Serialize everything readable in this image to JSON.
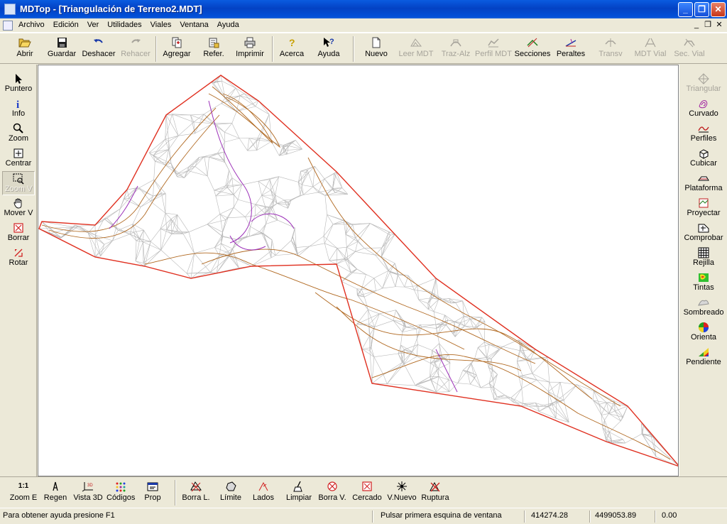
{
  "window": {
    "title": "MDTop - [Triangulación de Terreno2.MDT]",
    "minimize": "_",
    "maximize": "❐",
    "close": "✕"
  },
  "menu": {
    "items": [
      "Archivo",
      "Edición",
      "Ver",
      "Utilidades",
      "Viales",
      "Ventana",
      "Ayuda"
    ],
    "mdi_minimize": "_",
    "mdi_restore": "❐",
    "mdi_close": "✕"
  },
  "toolbar_top": {
    "abrir": "Abrir",
    "guardar": "Guardar",
    "deshacer": "Deshacer",
    "rehacer": "Rehacer",
    "agregar": "Agregar",
    "refer": "Refer.",
    "imprimir": "Imprimir",
    "acerca": "Acerca",
    "ayuda": "Ayuda",
    "nuevo": "Nuevo",
    "leer_mdt": "Leer MDT",
    "traz_alz": "Traz-Alz",
    "perfil_mdt": "Perfil MDT",
    "secciones": "Secciones",
    "peraltes": "Peraltes",
    "transv": "Transv",
    "mdt_vial": "MDT Vial",
    "sec_vial": "Sec. Vial"
  },
  "toolbar_left": {
    "puntero": "Puntero",
    "info": "Info",
    "zoom": "Zoom",
    "centrar": "Centrar",
    "zoom_v": "Zoom V",
    "mover_v": "Mover V",
    "borrar": "Borrar",
    "rotar": "Rotar"
  },
  "toolbar_right": {
    "triangular": "Triangular",
    "curvado": "Curvado",
    "perfiles": "Perfiles",
    "cubicar": "Cubicar",
    "plataforma": "Plataforma",
    "proyectar": "Proyectar",
    "comprobar": "Comprobar",
    "rejilla": "Rejilla",
    "tintas": "Tintas",
    "sombreado": "Sombreado",
    "orienta": "Orienta",
    "pendiente": "Pendiente"
  },
  "toolbar_bottom": {
    "zoom_e_icon": "1:1",
    "zoom_e": "Zoom E",
    "regen": "Regen",
    "vista_3d": "Vista 3D",
    "codigos": "Códigos",
    "prop": "Prop",
    "borra_l": "Borra L.",
    "limite": "Límite",
    "lados": "Lados",
    "limpiar": "Limpiar",
    "borra_v": "Borra V.",
    "cercado": "Cercado",
    "v_nuevo": "V.Nuevo",
    "ruptura": "Ruptura"
  },
  "status": {
    "help": "Para obtener ayuda presione F1",
    "prompt": "Pulsar primera esquina de ventana",
    "x": "414274.28",
    "y": "4499053.89",
    "z": "0.00"
  },
  "colors": {
    "boundary": "#e03020",
    "mesh": "#b8b8b8",
    "contour": "#b06820",
    "index_contour": "#9c30b8",
    "title_blue": "#0342c4"
  }
}
